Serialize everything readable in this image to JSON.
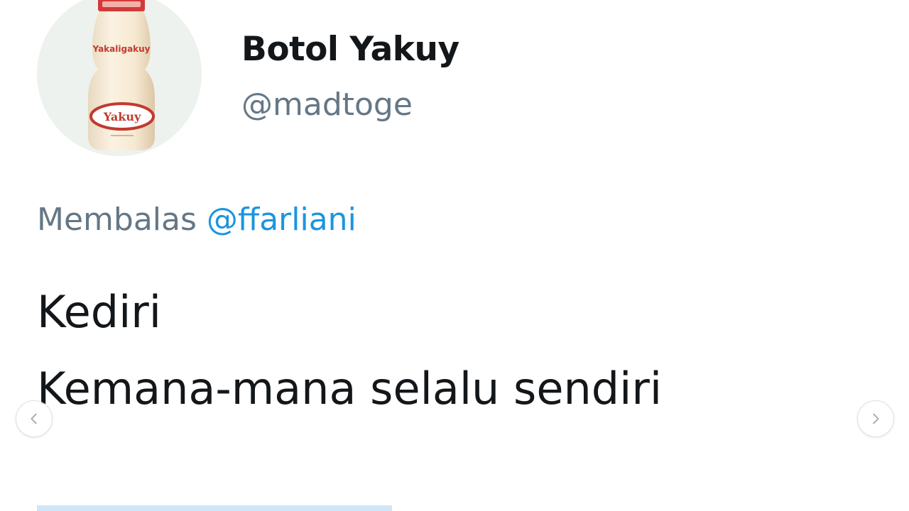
{
  "profile": {
    "display_name": "Botol Yakuy",
    "handle": "@madtoge",
    "avatar_label_top": "Yakaligakuy",
    "avatar_label_logo": "Yakuy"
  },
  "reply": {
    "prefix": "Membalas",
    "mention": "@ffarliani"
  },
  "tweet": {
    "lines": [
      "Kediri",
      "Kemana-mana selalu sendiri"
    ]
  },
  "carousel": {
    "prev_icon": "chevron-left-icon",
    "next_icon": "chevron-right-icon"
  },
  "colors": {
    "text": "#14171a",
    "secondary": "#657786",
    "link": "#1b95e0"
  }
}
